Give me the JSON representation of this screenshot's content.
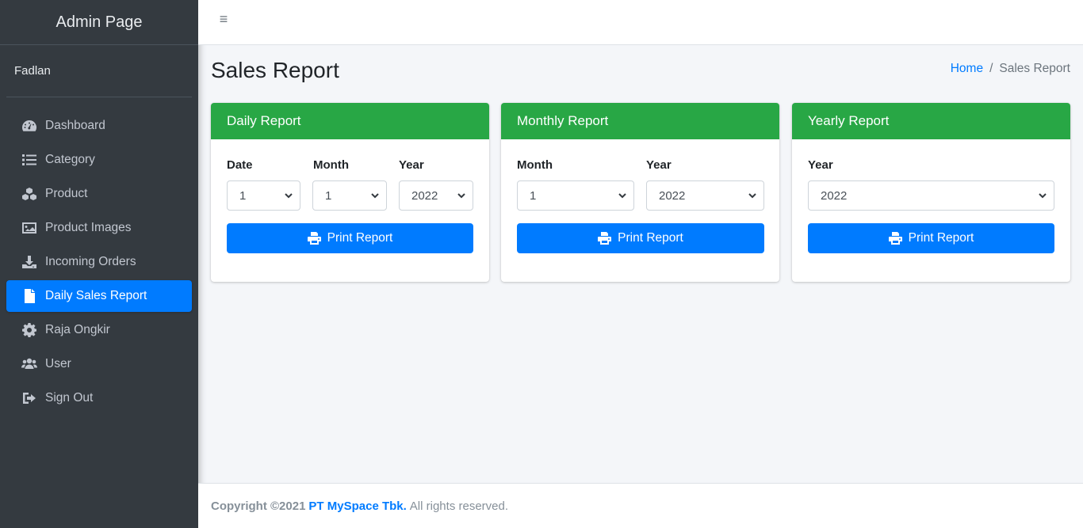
{
  "sidebar": {
    "brand": "Admin Page",
    "user": "Fadlan",
    "items": [
      {
        "label": "Dashboard",
        "icon": "tachometer-icon"
      },
      {
        "label": "Category",
        "icon": "list-icon"
      },
      {
        "label": "Product",
        "icon": "cubes-icon"
      },
      {
        "label": "Product Images",
        "icon": "image-icon"
      },
      {
        "label": "Incoming Orders",
        "icon": "download-icon"
      },
      {
        "label": "Daily Sales Report",
        "icon": "file-icon",
        "active": true
      },
      {
        "label": "Raja Ongkir",
        "icon": "cog-icon"
      },
      {
        "label": "User",
        "icon": "users-icon"
      },
      {
        "label": "Sign Out",
        "icon": "sign-out-icon"
      }
    ]
  },
  "topbar": {
    "menu_icon": "hamburger-icon"
  },
  "page": {
    "title": "Sales Report",
    "breadcrumb": {
      "home": "Home",
      "separator": "/",
      "current": "Sales Report"
    }
  },
  "cards": {
    "daily": {
      "title": "Daily Report",
      "date_label": "Date",
      "date_value": "1",
      "month_label": "Month",
      "month_value": "1",
      "year_label": "Year",
      "year_value": "2022",
      "button": "Print Report"
    },
    "monthly": {
      "title": "Monthly Report",
      "month_label": "Month",
      "month_value": "1",
      "year_label": "Year",
      "year_value": "2022",
      "button": "Print Report"
    },
    "yearly": {
      "title": "Yearly Report",
      "year_label": "Year",
      "year_value": "2022",
      "button": "Print Report"
    }
  },
  "footer": {
    "copyright": "Copyright ©2021",
    "company": "PT MySpace Tbk.",
    "rights": "All rights reserved."
  },
  "colors": {
    "sidebar_bg": "#343a40",
    "active": "#007bff",
    "card_header": "#28a745",
    "button": "#007bff"
  }
}
